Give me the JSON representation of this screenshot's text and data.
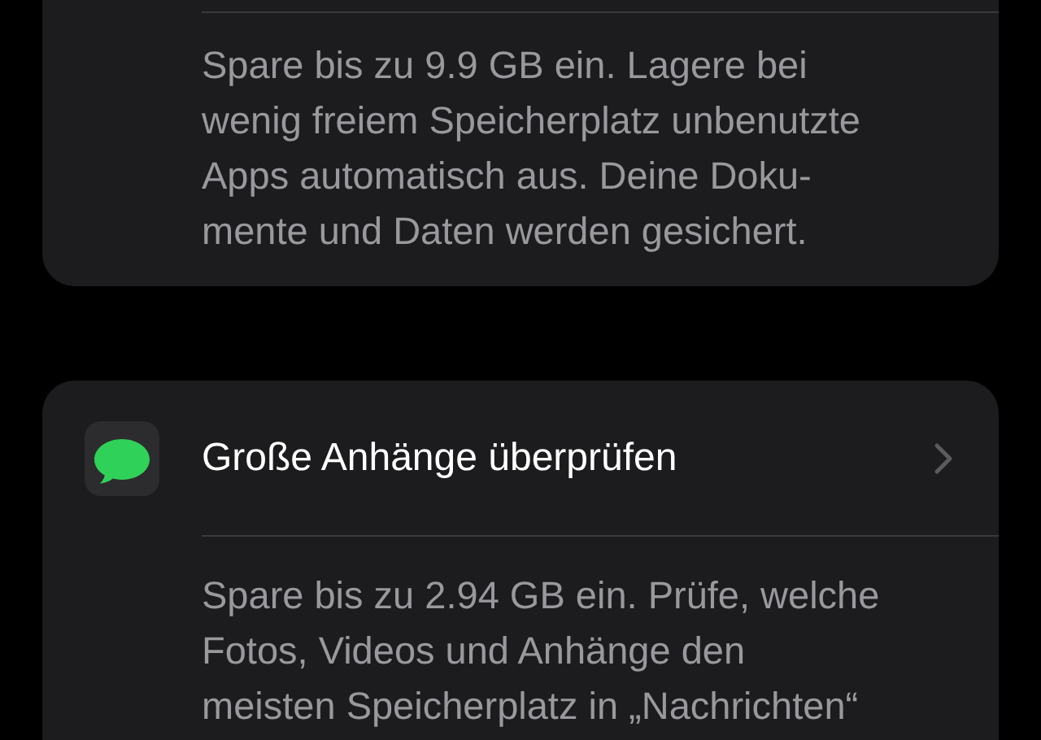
{
  "cards": [
    {
      "description": [
        "Spare bis zu 9.9 GB ein. Lagere bei",
        "wenig freiem Speicherplatz unbenutzte",
        "Apps automatisch aus. Deine Doku-",
        "mente und Daten werden gesichert."
      ]
    },
    {
      "title": "Große Anhänge überprüfen",
      "description": [
        "Spare bis zu 2.94 GB ein. Prüfe, welche",
        "Fotos, Videos und Anhänge den",
        "meisten Speicherplatz in „Nachrichten“"
      ]
    }
  ]
}
